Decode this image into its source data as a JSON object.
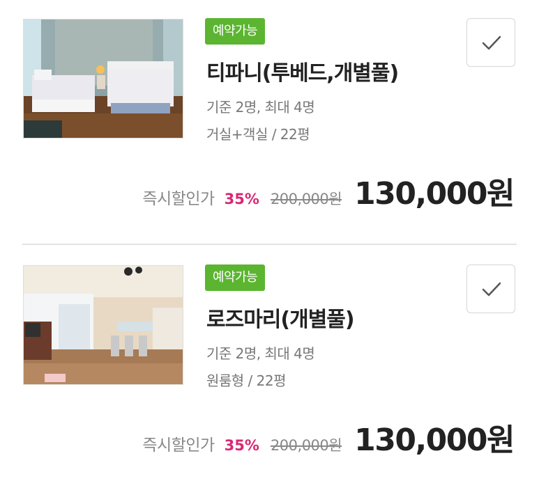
{
  "rooms": [
    {
      "badge": "예약가능",
      "name": "티파니(투베드,개별풀)",
      "capacity": "기준 2명, 최대 4명",
      "type_size": "거실+객실 / 22평",
      "discount_label": "즉시할인가",
      "discount_rate": "35%",
      "original_price": "200,000원",
      "final_price": "130,000원"
    },
    {
      "badge": "예약가능",
      "name": "로즈마리(개별풀)",
      "capacity": "기준 2명, 최대 4명",
      "type_size": "원룸형 / 22평",
      "discount_label": "즉시할인가",
      "discount_rate": "35%",
      "original_price": "200,000원",
      "final_price": "130,000원"
    }
  ],
  "icons": {
    "select": "check-icon"
  },
  "colors": {
    "badge_bg": "#5cb531",
    "discount_rate": "#d92775",
    "divider": "#e3e3e3"
  }
}
